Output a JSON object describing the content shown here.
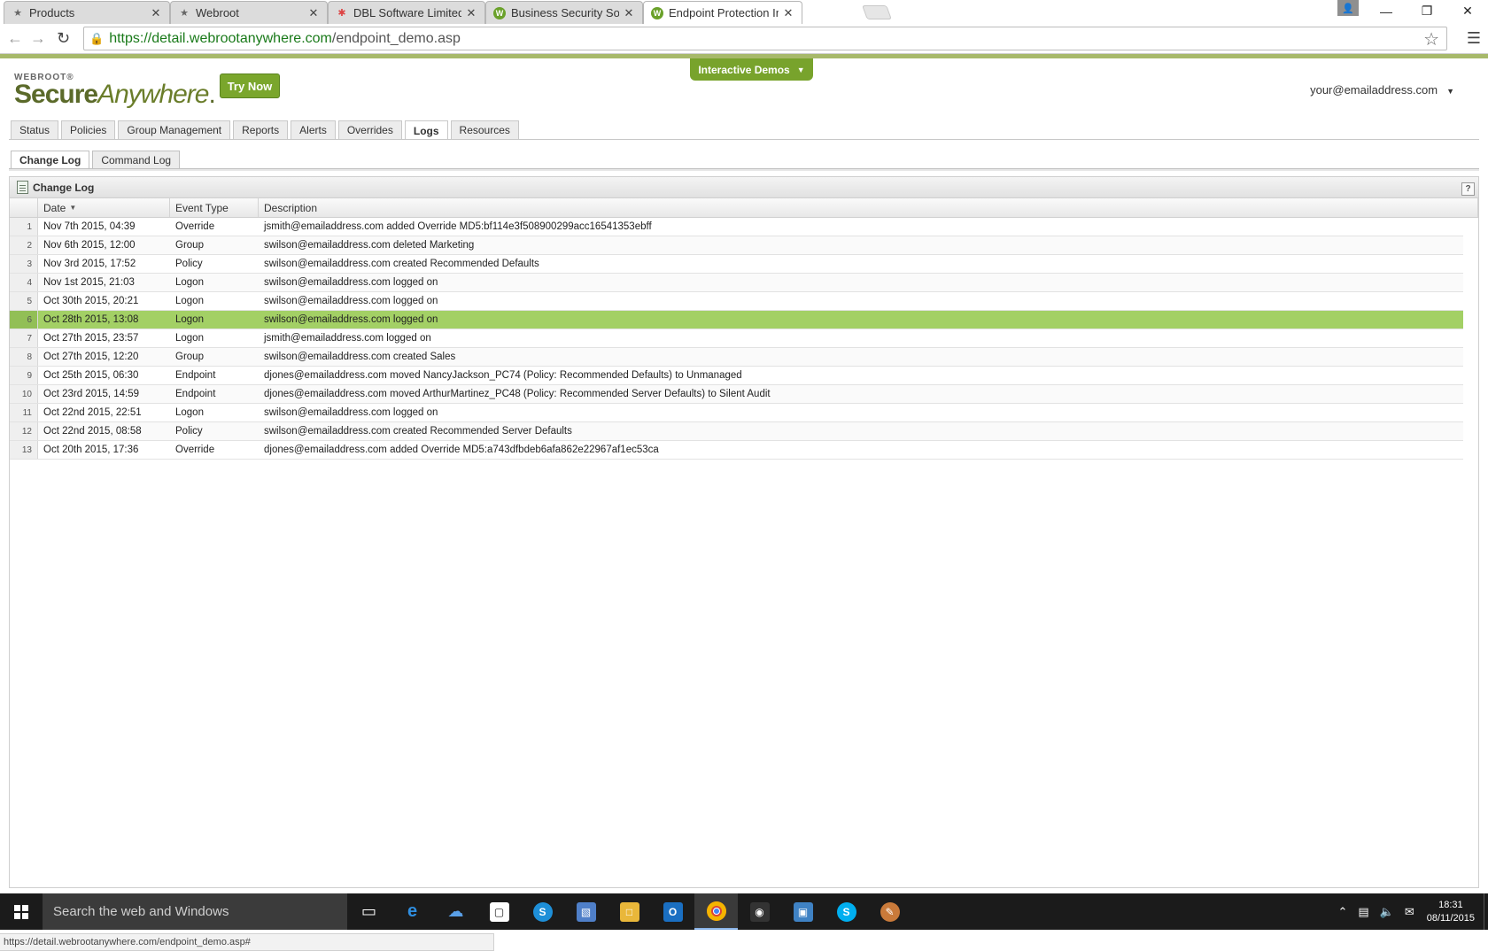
{
  "browser": {
    "tabs": [
      {
        "title": "Products",
        "icon": "star"
      },
      {
        "title": "Webroot",
        "icon": "star"
      },
      {
        "title": "DBL Software Limited - Ac",
        "icon": "dbl"
      },
      {
        "title": "Business Security Solution",
        "icon": "webroot"
      },
      {
        "title": "Endpoint Protection Intera",
        "icon": "webroot",
        "active": true
      }
    ],
    "close_glyph": "✕",
    "url_host": "https://detail.webrootanywhere.com",
    "url_path": "/endpoint_demo.asp",
    "status_url": "https://detail.webrootanywhere.com/endpoint_demo.asp#"
  },
  "header": {
    "brand_small": "WEBROOT®",
    "brand_secure": "Secure",
    "brand_anywhere": "Anywhere",
    "brand_dot": ".",
    "try_now": "Try Now",
    "demos_label": "Interactive Demos",
    "account": "your@emailaddress.com"
  },
  "main_tabs": [
    "Status",
    "Policies",
    "Group Management",
    "Reports",
    "Alerts",
    "Overrides",
    "Logs",
    "Resources"
  ],
  "active_main_tab": "Logs",
  "sub_tabs": [
    "Change Log",
    "Command Log"
  ],
  "active_sub_tab": "Change Log",
  "panel": {
    "title": "Change Log",
    "help": "?",
    "columns": {
      "date": "Date",
      "event_type": "Event Type",
      "description": "Description"
    },
    "selected_row": 6,
    "rows": [
      {
        "n": "1",
        "date": "Nov 7th 2015, 04:39",
        "type": "Override",
        "desc": "jsmith@emailaddress.com added Override MD5:bf114e3f508900299acc16541353ebff"
      },
      {
        "n": "2",
        "date": "Nov 6th 2015, 12:00",
        "type": "Group",
        "desc": "swilson@emailaddress.com deleted Marketing"
      },
      {
        "n": "3",
        "date": "Nov 3rd 2015, 17:52",
        "type": "Policy",
        "desc": "swilson@emailaddress.com created Recommended Defaults"
      },
      {
        "n": "4",
        "date": "Nov 1st 2015, 21:03",
        "type": "Logon",
        "desc": "swilson@emailaddress.com logged on"
      },
      {
        "n": "5",
        "date": "Oct 30th 2015, 20:21",
        "type": "Logon",
        "desc": "swilson@emailaddress.com logged on"
      },
      {
        "n": "6",
        "date": "Oct 28th 2015, 13:08",
        "type": "Logon",
        "desc": "swilson@emailaddress.com logged on"
      },
      {
        "n": "7",
        "date": "Oct 27th 2015, 23:57",
        "type": "Logon",
        "desc": "jsmith@emailaddress.com logged on"
      },
      {
        "n": "8",
        "date": "Oct 27th 2015, 12:20",
        "type": "Group",
        "desc": "swilson@emailaddress.com created Sales"
      },
      {
        "n": "9",
        "date": "Oct 25th 2015, 06:30",
        "type": "Endpoint",
        "desc": "djones@emailaddress.com moved NancyJackson_PC74 (Policy: Recommended Defaults) to Unmanaged"
      },
      {
        "n": "10",
        "date": "Oct 23rd 2015, 14:59",
        "type": "Endpoint",
        "desc": "djones@emailaddress.com moved ArthurMartinez_PC48 (Policy: Recommended Server Defaults) to Silent Audit"
      },
      {
        "n": "11",
        "date": "Oct 22nd 2015, 22:51",
        "type": "Logon",
        "desc": "swilson@emailaddress.com logged on"
      },
      {
        "n": "12",
        "date": "Oct 22nd 2015, 08:58",
        "type": "Policy",
        "desc": "swilson@emailaddress.com created Recommended Server Defaults"
      },
      {
        "n": "13",
        "date": "Oct 20th 2015, 17:36",
        "type": "Override",
        "desc": "djones@emailaddress.com added Override MD5:a743dfbdeb6afa862e22967af1ec53ca"
      }
    ]
  },
  "taskbar": {
    "search_placeholder": "Search the web and Windows",
    "time": "18:31",
    "date": "08/11/2015"
  },
  "colors": {
    "accent_green": "#78a32c",
    "selected_row": "#a3d065"
  }
}
